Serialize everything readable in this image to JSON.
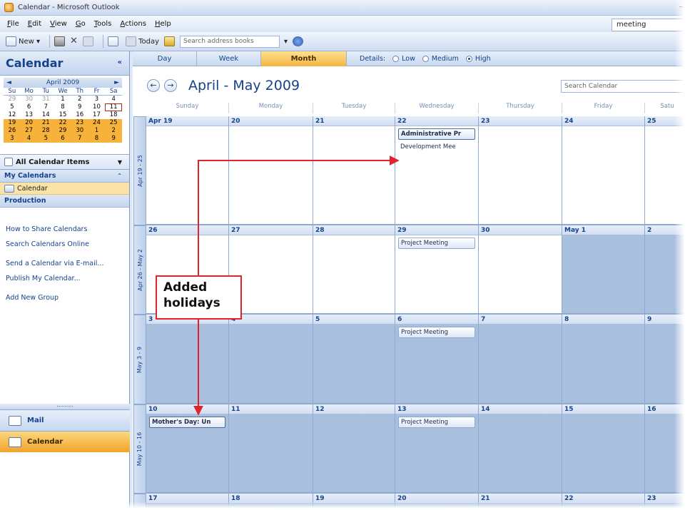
{
  "window": {
    "title": "Calendar - Microsoft Outlook"
  },
  "menu": [
    "File",
    "Edit",
    "View",
    "Go",
    "Tools",
    "Actions",
    "Help"
  ],
  "help_search": "meeting",
  "toolbar": {
    "new_label": "New",
    "today_label": "Today",
    "address_search_placeholder": "Search address books"
  },
  "nav": {
    "title": "Calendar",
    "collapse_glyph": "«",
    "minical": {
      "title": "April 2009",
      "prev_glyph": "◄",
      "next_glyph": "►",
      "dow": [
        "Su",
        "Mo",
        "Tu",
        "We",
        "Th",
        "Fr",
        "Sa"
      ],
      "weeks": [
        [
          "29",
          "30",
          "31",
          "1",
          "2",
          "3",
          "4"
        ],
        [
          "5",
          "6",
          "7",
          "8",
          "9",
          "10",
          "11"
        ],
        [
          "12",
          "13",
          "14",
          "15",
          "16",
          "17",
          "18"
        ],
        [
          "19",
          "20",
          "21",
          "22",
          "23",
          "24",
          "25"
        ],
        [
          "26",
          "27",
          "28",
          "29",
          "30",
          "1",
          "2"
        ],
        [
          "3",
          "4",
          "5",
          "6",
          "7",
          "8",
          "9"
        ]
      ]
    },
    "all_items_label": "All Calendar Items",
    "my_calendars_label": "My Calendars",
    "calendar_entry": "Calendar",
    "production_label": "Production",
    "links": [
      "How to Share Calendars",
      "Search Calendars Online",
      "Send a Calendar via E-mail...",
      "Publish My Calendar...",
      "Add New Group"
    ],
    "mail_button": "Mail",
    "calendar_button": "Calendar"
  },
  "view": {
    "tabs": [
      "Day",
      "Week",
      "Month"
    ],
    "active_tab": "Month",
    "details_label": "Details:",
    "detail_options": [
      "Low",
      "Medium",
      "High"
    ],
    "detail_selected": "High"
  },
  "header": {
    "range_title": "April - May 2009",
    "search_placeholder": "Search Calendar",
    "prev_glyph": "←",
    "next_glyph": "→"
  },
  "dow": [
    "Sunday",
    "Monday",
    "Tuesday",
    "Wednesday",
    "Thursday",
    "Friday",
    "Satu"
  ],
  "weeks": [
    {
      "label": "Apr 19 - 25",
      "days": [
        "Apr 19",
        "20",
        "21",
        "22",
        "23",
        "24",
        "25"
      ]
    },
    {
      "label": "Apr 26 - May 2",
      "days": [
        "26",
        "27",
        "28",
        "29",
        "30",
        "May 1",
        "2"
      ]
    },
    {
      "label": "May 3 - 9",
      "days": [
        "3",
        "4",
        "5",
        "6",
        "7",
        "8",
        "9"
      ]
    },
    {
      "label": "May 10 - 16",
      "days": [
        "10",
        "11",
        "12",
        "13",
        "14",
        "15",
        "16"
      ]
    },
    {
      "label": "",
      "days": [
        "17",
        "18",
        "19",
        "20",
        "21",
        "22",
        "23"
      ]
    }
  ],
  "appointments": {
    "w0_wed_1": "Administrative Pr",
    "w0_wed_2": "Development Mee",
    "w1_wed": "Project Meeting",
    "w2_wed": "Project Meeting",
    "w3_sun": "Mother's Day: Un",
    "w3_wed": "Project Meeting"
  },
  "callout": {
    "line1": "Added",
    "line2": "holidays"
  },
  "colors": {
    "accent": "#f5b442",
    "annotation": "#e0242c",
    "nonwork": "#a8bfde"
  }
}
